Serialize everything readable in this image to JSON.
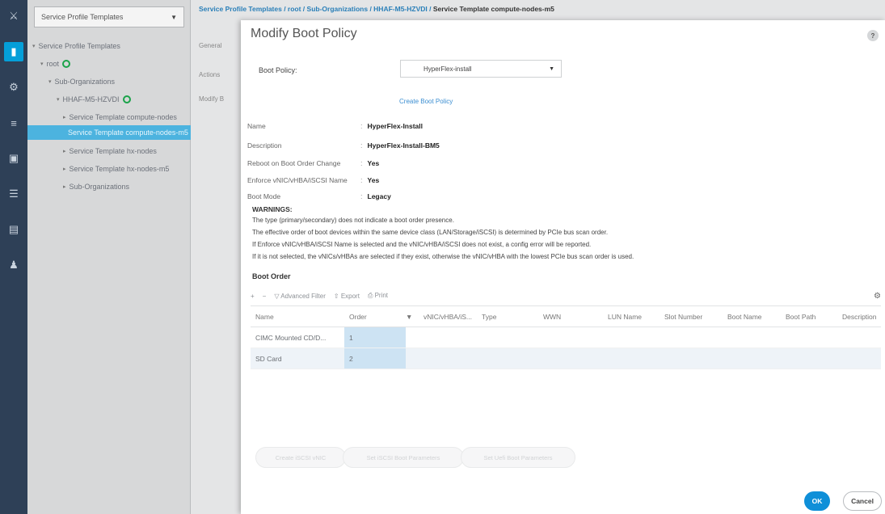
{
  "rail": {
    "icons": [
      "network-icon",
      "server-icon",
      "lan-icon",
      "san-icon",
      "vm-icon",
      "storage-icon",
      "chassis-icon",
      "admin-icon"
    ]
  },
  "nav": {
    "select_value": "Service Profile Templates",
    "tree": [
      {
        "label": "Service Profile Templates"
      },
      {
        "label": "root"
      },
      {
        "label": "Sub-Organizations"
      },
      {
        "label": "HHAF-M5-HZVDI"
      },
      {
        "label": "Service Template compute-nodes"
      },
      {
        "label": "Service Template compute-nodes-m5"
      },
      {
        "label": "Service Template hx-nodes"
      },
      {
        "label": "Service Template hx-nodes-m5"
      },
      {
        "label": "Sub-Organizations"
      }
    ]
  },
  "background": {
    "breadcrumb_path": "Service Profile Templates / root / Sub-Organizations / HHAF-M5-HZVDI /",
    "breadcrumb_last": "Service Template compute-nodes-m5",
    "tab_general": "General",
    "tab_actions": "Actions",
    "tab_modify": "Modify B"
  },
  "modal": {
    "title": "Modify Boot Policy",
    "help": "?",
    "boot_policy_label": "Boot Policy:",
    "boot_policy_value": "HyperFlex-install",
    "create_link": "Create Boot Policy",
    "props": [
      {
        "k": "Name",
        "v": "HyperFlex-Install"
      },
      {
        "k": "Description",
        "v": "HyperFlex-Install-BM5"
      },
      {
        "k": "Reboot on Boot Order Change",
        "v": "Yes"
      },
      {
        "k": "Enforce vNIC/vHBA/iSCSI Name",
        "v": "Yes"
      },
      {
        "k": "Boot Mode",
        "v": "Legacy"
      }
    ],
    "warnings_title": "WARNINGS:",
    "warnings": [
      "The type (primary/secondary) does not indicate a boot order presence.",
      "The effective order of boot devices within the same device class (LAN/Storage/iSCSI) is determined by PCIe bus scan order.",
      "If Enforce vNIC/vHBA/iSCSI Name is selected and the vNIC/vHBA/iSCSI does not exist, a config error will be reported.",
      "If it is not selected, the vNICs/vHBAs are selected if they exist, otherwise the vNIC/vHBA with the lowest PCIe bus scan order is used."
    ],
    "boot_order_title": "Boot Order",
    "toolbar": {
      "add": "+",
      "remove": "−",
      "filter": "Advanced Filter",
      "export": "Export",
      "print": "Print",
      "settings": "⚙"
    },
    "columns": [
      "Name",
      "Order",
      "vNIC/vHBA/iS...",
      "Type",
      "WWN",
      "LUN Name",
      "Slot Number",
      "Boot Name",
      "Boot Path",
      "Description"
    ],
    "rows": [
      {
        "name": "CIMC Mounted CD/D...",
        "order": "1"
      },
      {
        "name": "SD Card",
        "order": "2"
      }
    ],
    "bottom_buttons": [
      "Create iSCSI vNIC",
      "Set iSCSI Boot Parameters",
      "Set Uefi Boot Parameters"
    ],
    "ok": "OK",
    "cancel": "Cancel"
  }
}
